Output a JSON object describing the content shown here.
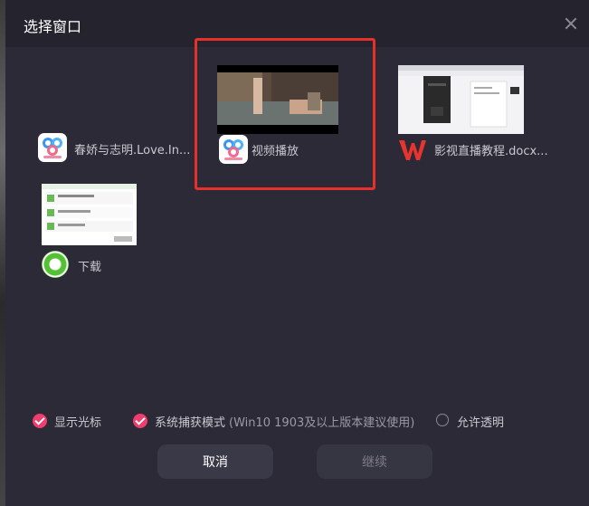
{
  "dialog": {
    "title": "选择窗口"
  },
  "windows": [
    {
      "label": "春娇与志明.Love.In...",
      "icon": "video-player-icon"
    },
    {
      "label": "视频播放",
      "icon": "video-player-icon",
      "selected": true
    },
    {
      "label": "影视直播教程.docx...",
      "icon": "wps-icon"
    },
    {
      "label": "下载",
      "icon": "download-icon"
    }
  ],
  "options": {
    "show_cursor": {
      "label": "显示光标",
      "checked": true
    },
    "system_capture": {
      "label": "系统捕获模式",
      "hint": "(Win10 1903及以上版本建议使用)",
      "checked": true
    },
    "allow_transparent": {
      "label": "允许透明",
      "checked": false
    }
  },
  "buttons": {
    "cancel": "取消",
    "continue": "继续"
  },
  "colors": {
    "accent": "#ef3d6e",
    "highlight": "#e8302a",
    "dialog_bg": "#2b2a36"
  }
}
